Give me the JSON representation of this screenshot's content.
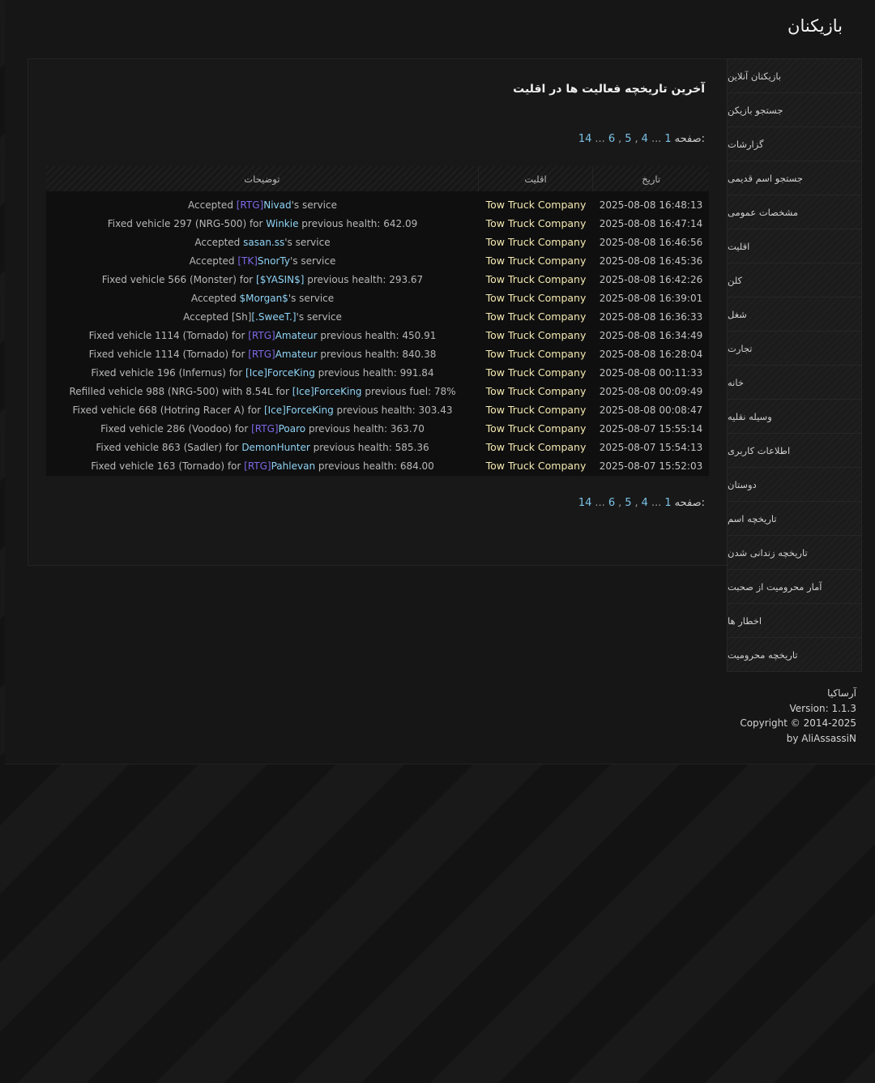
{
  "header": {
    "title": "بازیکنان"
  },
  "sidebar": {
    "items": [
      {
        "label": "بازیکنان آنلاین"
      },
      {
        "label": "جستجو بازیکن"
      },
      {
        "label": "گزارشات"
      },
      {
        "label": "جستجو اسم قدیمی"
      },
      {
        "label": "مشخصات عمومی"
      },
      {
        "label": "اقلیت"
      },
      {
        "label": "کلن"
      },
      {
        "label": "شغل"
      },
      {
        "label": "تجارت"
      },
      {
        "label": "خانه"
      },
      {
        "label": "وسیله نقلیه"
      },
      {
        "label": "اطلاعات کاربری"
      },
      {
        "label": "دوستان"
      },
      {
        "label": "تاریخچه اسم"
      },
      {
        "label": "تاریخچه زندانی شدن"
      },
      {
        "label": "آمار محرومیت از صحبت"
      },
      {
        "label": "اخطار ها"
      },
      {
        "label": "تاریخچه محرومیت"
      }
    ]
  },
  "panel": {
    "title": "آخرین تاریخچه فعالیت ها در اقلیت",
    "pager": {
      "label": "صفحه:",
      "first": "1",
      "ellipsis1": "...",
      "p4": "4",
      "comma1": ",",
      "p5": "5",
      "comma2": ",",
      "p6": "6",
      "ellipsis2": "...",
      "last": "14"
    },
    "columns": {
      "description": "توضیحات",
      "faction": "اقلیت",
      "date": "تاریخ"
    },
    "rows": [
      {
        "pre": "Accepted ",
        "tag": "[RTG]",
        "player": "Nivad",
        "post": "'s service",
        "faction": "Tow Truck Company",
        "date": "2025-08-08 16:48:13"
      },
      {
        "pre": "Fixed vehicle 297 (NRG-500) for ",
        "tag": "",
        "player": "Winkie",
        "post": " previous health: 642.09",
        "faction": "Tow Truck Company",
        "date": "2025-08-08 16:47:14"
      },
      {
        "pre": "Accepted ",
        "tag": "",
        "player": "sasan.ss",
        "post": "'s service",
        "faction": "Tow Truck Company",
        "date": "2025-08-08 16:46:56"
      },
      {
        "pre": "Accepted ",
        "tag": "[TK]",
        "player": "SnorTy",
        "post": "'s service",
        "faction": "Tow Truck Company",
        "date": "2025-08-08 16:45:36"
      },
      {
        "pre": "Fixed vehicle 566 (Monster) for ",
        "tag": "",
        "player": "[$YASIN$]",
        "post": " previous health: 293.67",
        "faction": "Tow Truck Company",
        "date": "2025-08-08 16:42:26"
      },
      {
        "pre": "Accepted ",
        "tag": "",
        "player": "$Morgan$",
        "post": "'s service",
        "faction": "Tow Truck Company",
        "date": "2025-08-08 16:39:01"
      },
      {
        "pre": "Accepted [Sh]",
        "tag": "",
        "player": "[.SweeT.]",
        "post": "'s service",
        "faction": "Tow Truck Company",
        "date": "2025-08-08 16:36:33"
      },
      {
        "pre": "Fixed vehicle 1114 (Tornado) for ",
        "tag": "[RTG]",
        "player": "Amateur",
        "post": " previous health: 450.91",
        "faction": "Tow Truck Company",
        "date": "2025-08-08 16:34:49"
      },
      {
        "pre": "Fixed vehicle 1114 (Tornado) for ",
        "tag": "[RTG]",
        "player": "Amateur",
        "post": " previous health: 840.38",
        "faction": "Tow Truck Company",
        "date": "2025-08-08 16:28:04"
      },
      {
        "pre": "Fixed vehicle 196 (Infernus) for ",
        "tag": "",
        "player": "[Ice]ForceKing",
        "post": " previous health: 991.84",
        "faction": "Tow Truck Company",
        "date": "2025-08-08 00:11:33"
      },
      {
        "pre": "Refilled vehicle 988 (NRG-500) with 8.54L for ",
        "tag": "",
        "player": "[Ice]ForceKing",
        "post": " previous fuel: 78%",
        "faction": "Tow Truck Company",
        "date": "2025-08-08 00:09:49"
      },
      {
        "pre": "Fixed vehicle 668 (Hotring Racer A) for ",
        "tag": "",
        "player": "[Ice]ForceKing",
        "post": " previous health: 303.43",
        "faction": "Tow Truck Company",
        "date": "2025-08-08 00:08:47"
      },
      {
        "pre": "Fixed vehicle 286 (Voodoo) for ",
        "tag": "[RTG]",
        "player": "Poaro",
        "post": " previous health: 363.70",
        "faction": "Tow Truck Company",
        "date": "2025-08-07 15:55:14"
      },
      {
        "pre": "Fixed vehicle 863 (Sadler) for ",
        "tag": "",
        "player": "DemonHunter",
        "post": " previous health: 585.36",
        "faction": "Tow Truck Company",
        "date": "2025-08-07 15:54:13"
      },
      {
        "pre": "Fixed vehicle 163 (Tornado) for ",
        "tag": "[RTG]",
        "player": "Pahlevan",
        "post": " previous health: 684.00",
        "faction": "Tow Truck Company",
        "date": "2025-08-07 15:52:03"
      }
    ]
  },
  "footer": {
    "site": "آرساکیا",
    "version": "Version: 1.1.3",
    "copyright": "Copyright © 2014-2025",
    "author": "by AliAssassiN"
  },
  "colors": {
    "faction": "#f4eab2",
    "tag": "#7e68e8",
    "player": "#8fd3f5",
    "link": "#7cc2e8"
  }
}
